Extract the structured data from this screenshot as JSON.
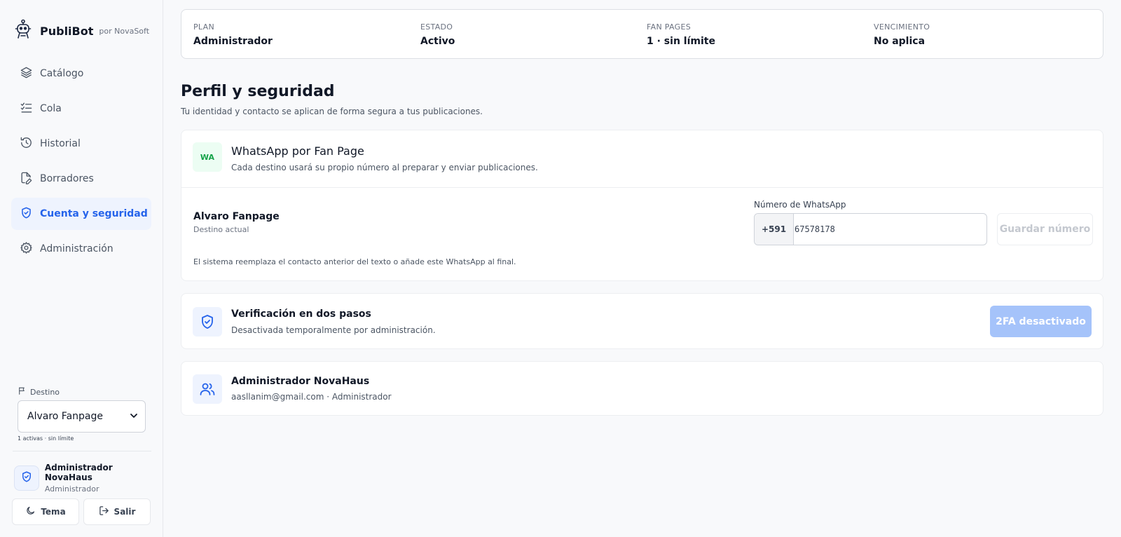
{
  "brand": {
    "name": "PubliBot",
    "sub": "por NovaSoft",
    "icon": "robot-icon"
  },
  "nav": [
    {
      "label": "Catálogo",
      "icon": "layers-icon",
      "active": false
    },
    {
      "label": "Cola",
      "icon": "list-check-icon",
      "active": false
    },
    {
      "label": "Historial",
      "icon": "history-icon",
      "active": false
    },
    {
      "label": "Borradores",
      "icon": "file-edit-icon",
      "active": false
    },
    {
      "label": "Cuenta y seguridad",
      "icon": "shield-check-icon",
      "active": true
    },
    {
      "label": "Administración",
      "icon": "gear-icon",
      "active": false
    }
  ],
  "sidebar": {
    "destino_label": "Destino",
    "destino_value": "Alvaro Fanpage",
    "destino_meta": "1 activas · sin límite",
    "user_name": "Administrador NovaHaus",
    "user_role": "Administrador",
    "theme_label": "Tema",
    "logout_label": "Salir"
  },
  "plan": [
    {
      "key": "PLAN",
      "value": "Administrador"
    },
    {
      "key": "ESTADO",
      "value": "Activo"
    },
    {
      "key": "FAN PAGES",
      "value": "1 · sin límite"
    },
    {
      "key": "VENCIMIENTO",
      "value": "No aplica"
    }
  ],
  "section": {
    "title": "Perfil y seguridad",
    "subtitle": "Tu identidad y contacto se aplican de forma segura a tus publicaciones."
  },
  "whatsapp": {
    "badge": "WA",
    "title": "WhatsApp por Fan Page",
    "subtitle": "Cada destino usará su propio número al preparar y enviar publicaciones.",
    "fanpage_name": "Alvaro Fanpage",
    "fanpage_sub": "Destino actual",
    "field_label": "Número de WhatsApp",
    "prefix": "+591",
    "number": "67578178",
    "save_label": "Guardar número",
    "note": "El sistema reemplaza el contacto anterior del texto o añade este WhatsApp al final."
  },
  "twofa": {
    "title": "Verificación en dos pasos",
    "subtitle": "Desactivada temporalmente por administración.",
    "button_label": "2FA desactivado"
  },
  "account": {
    "name": "Administrador NovaHaus",
    "detail": "aasllanim@gmail.com · Administrador"
  },
  "colors": {
    "accent": "#2563eb",
    "active_bg": "#eef3fe",
    "wa_green": "#16a34a",
    "disabled_blue": "#a5c3fa"
  }
}
